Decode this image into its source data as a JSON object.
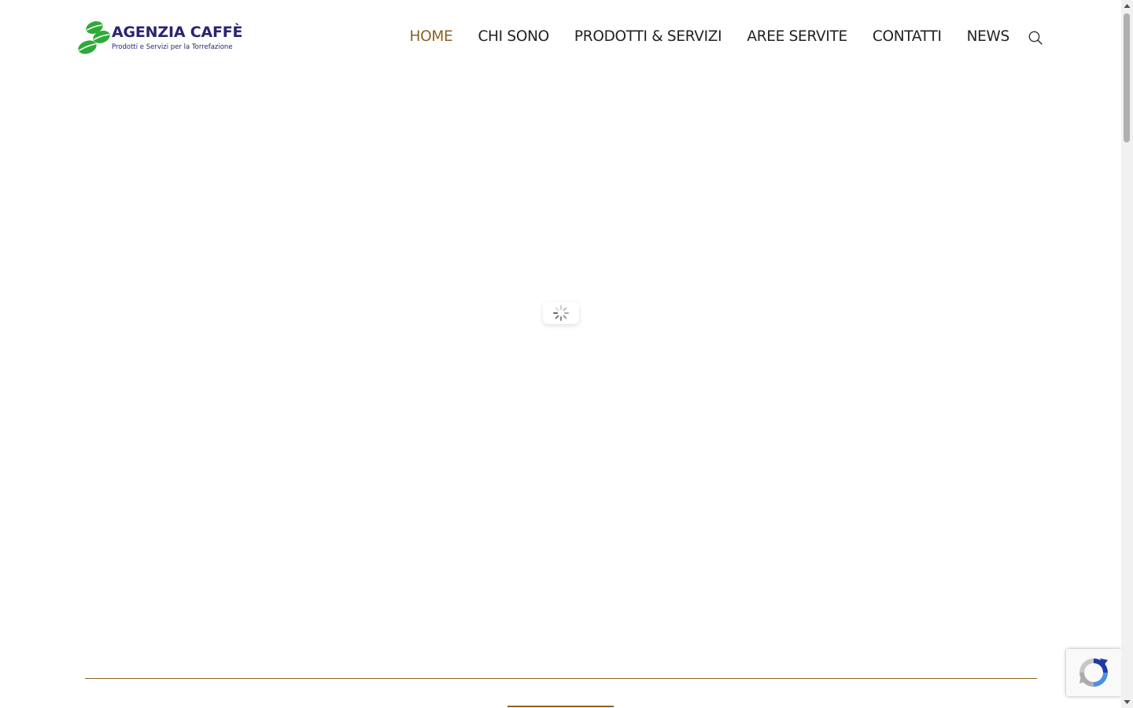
{
  "logo": {
    "title": "AGENZIA CAFFÈ",
    "subtitle": "Prodotti e Servizi per la Torrefazione",
    "brand_colors": {
      "beans": "#2faa3a",
      "text": "#2a2470"
    }
  },
  "nav": {
    "items": [
      {
        "label": "HOME",
        "active": true
      },
      {
        "label": "CHI SONO",
        "active": false
      },
      {
        "label": "PRODOTTI & SERVIZI",
        "active": false
      },
      {
        "label": "AREE SERVITE",
        "active": false
      },
      {
        "label": "CONTATTI",
        "active": false
      },
      {
        "label": "NEWS",
        "active": false
      }
    ],
    "search_icon": "search-icon"
  },
  "loader": {
    "icon": "spinner-icon"
  },
  "recaptcha": {
    "icon": "recaptcha-icon"
  },
  "colors": {
    "accent": "#8b6123",
    "nav_text": "#222222",
    "background": "#ffffff"
  }
}
